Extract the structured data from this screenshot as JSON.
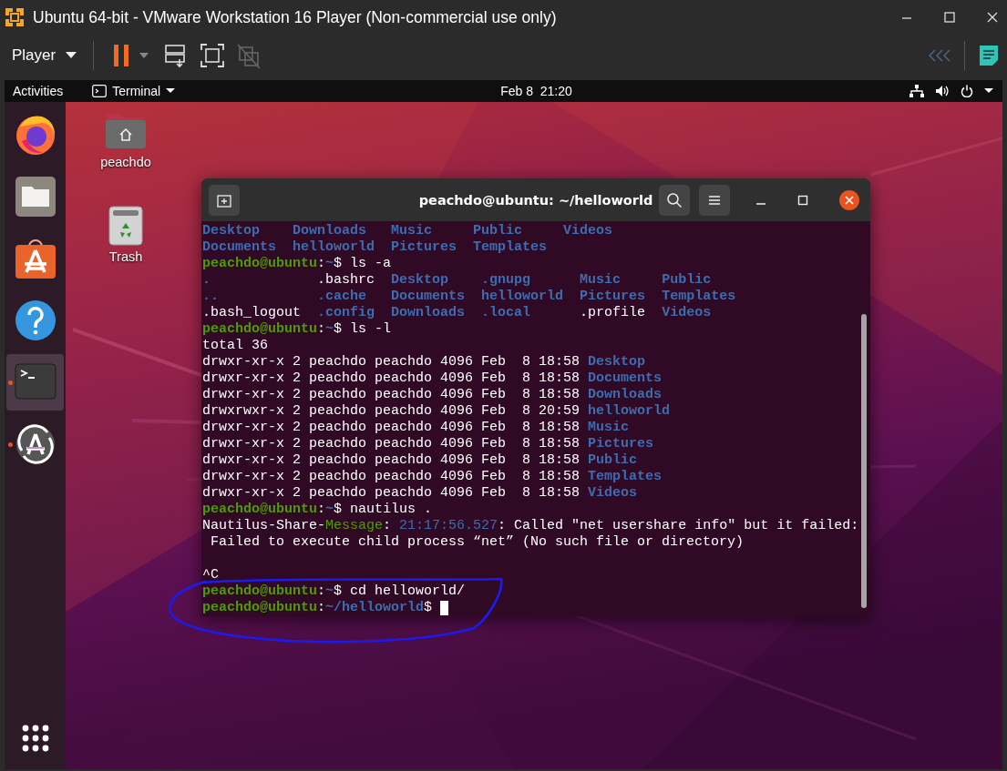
{
  "vm_window": {
    "title": "Ubuntu 64-bit - VMware Workstation 16 Player (Non-commercial use only)"
  },
  "vm_toolbar": {
    "menu": "Player",
    "buttons": [
      {
        "kind": "pause",
        "disabled": false
      },
      {
        "kind": "send_keys",
        "disabled": false
      },
      {
        "kind": "fullscreen",
        "disabled": false
      },
      {
        "kind": "unity",
        "disabled": true
      }
    ]
  },
  "top_bar": {
    "activities": "Activities",
    "app_menu": "Terminal",
    "clock": "Feb 8  21:20"
  },
  "dock": {
    "items": [
      {
        "kind": "browser",
        "selected": false,
        "running": false
      },
      {
        "kind": "files",
        "selected": false,
        "running": false
      },
      {
        "kind": "software",
        "selected": false,
        "running": false
      },
      {
        "kind": "help",
        "selected": false,
        "running": false
      },
      {
        "kind": "terminal",
        "selected": true,
        "running": true
      },
      {
        "kind": "updater",
        "selected": false,
        "running": true
      }
    ]
  },
  "desktop_icons": [
    {
      "kind": "home",
      "label": "peachdo"
    },
    {
      "kind": "trash",
      "label": "Trash"
    }
  ],
  "terminal": {
    "title": "peachdo@ubuntu: ~/helloworld",
    "cursor": true,
    "lines": [
      {
        "kind": "text",
        "segments": [
          {
            "kind": "dir",
            "text": "Desktop    "
          },
          {
            "kind": "dir",
            "text": "Downloads   "
          },
          {
            "kind": "dir",
            "text": "Music     "
          },
          {
            "kind": "dir",
            "text": "Public     "
          },
          {
            "kind": "dir",
            "text": "Videos"
          }
        ]
      },
      {
        "kind": "text",
        "segments": [
          {
            "kind": "dir",
            "text": "Documents  "
          },
          {
            "kind": "dir",
            "text": "helloworld  "
          },
          {
            "kind": "dir",
            "text": "Pictures  "
          },
          {
            "kind": "dir",
            "text": "Templates"
          }
        ]
      },
      {
        "kind": "text",
        "segments": [
          {
            "kind": "user",
            "text": "peachdo@ubuntu"
          },
          {
            "kind": "plain",
            "text": ":"
          },
          {
            "kind": "path",
            "text": "~"
          },
          {
            "kind": "plain",
            "text": "$ ls -a"
          }
        ]
      },
      {
        "kind": "text",
        "segments": [
          {
            "kind": "dir",
            "text": ".             "
          },
          {
            "kind": "plain",
            "text": ".bashrc  "
          },
          {
            "kind": "dir",
            "text": "Desktop    "
          },
          {
            "kind": "dir",
            "text": ".gnupg      "
          },
          {
            "kind": "dir",
            "text": "Music     "
          },
          {
            "kind": "dir",
            "text": "Public"
          }
        ]
      },
      {
        "kind": "text",
        "segments": [
          {
            "kind": "dir",
            "text": "..            "
          },
          {
            "kind": "dir",
            "text": ".cache   "
          },
          {
            "kind": "dir",
            "text": "Documents  "
          },
          {
            "kind": "dir",
            "text": "helloworld  "
          },
          {
            "kind": "dir",
            "text": "Pictures  "
          },
          {
            "kind": "dir",
            "text": "Templates"
          }
        ]
      },
      {
        "kind": "text",
        "segments": [
          {
            "kind": "plain",
            "text": ".bash_logout  "
          },
          {
            "kind": "dir",
            "text": ".config  "
          },
          {
            "kind": "dir",
            "text": "Downloads  "
          },
          {
            "kind": "dir",
            "text": ".local      "
          },
          {
            "kind": "plain",
            "text": ".profile  "
          },
          {
            "kind": "dir",
            "text": "Videos"
          }
        ]
      },
      {
        "kind": "text",
        "segments": [
          {
            "kind": "user",
            "text": "peachdo@ubuntu"
          },
          {
            "kind": "plain",
            "text": ":"
          },
          {
            "kind": "path",
            "text": "~"
          },
          {
            "kind": "plain",
            "text": "$ ls -l"
          }
        ]
      },
      {
        "kind": "text",
        "segments": [
          {
            "kind": "plain",
            "text": "total 36"
          }
        ]
      },
      {
        "kind": "text",
        "segments": [
          {
            "kind": "plain",
            "text": "drwxr-xr-x 2 peachdo peachdo 4096 Feb  8 18:58 "
          },
          {
            "kind": "dir",
            "text": "Desktop"
          }
        ]
      },
      {
        "kind": "text",
        "segments": [
          {
            "kind": "plain",
            "text": "drwxr-xr-x 2 peachdo peachdo 4096 Feb  8 18:58 "
          },
          {
            "kind": "dir",
            "text": "Documents"
          }
        ]
      },
      {
        "kind": "text",
        "segments": [
          {
            "kind": "plain",
            "text": "drwxr-xr-x 2 peachdo peachdo 4096 Feb  8 18:58 "
          },
          {
            "kind": "dir",
            "text": "Downloads"
          }
        ]
      },
      {
        "kind": "text",
        "segments": [
          {
            "kind": "plain",
            "text": "drwxrwxr-x 2 peachdo peachdo 4096 Feb  8 20:59 "
          },
          {
            "kind": "dir",
            "text": "helloworld"
          }
        ]
      },
      {
        "kind": "text",
        "segments": [
          {
            "kind": "plain",
            "text": "drwxr-xr-x 2 peachdo peachdo 4096 Feb  8 18:58 "
          },
          {
            "kind": "dir",
            "text": "Music"
          }
        ]
      },
      {
        "kind": "text",
        "segments": [
          {
            "kind": "plain",
            "text": "drwxr-xr-x 2 peachdo peachdo 4096 Feb  8 18:58 "
          },
          {
            "kind": "dir",
            "text": "Pictures"
          }
        ]
      },
      {
        "kind": "text",
        "segments": [
          {
            "kind": "plain",
            "text": "drwxr-xr-x 2 peachdo peachdo 4096 Feb  8 18:58 "
          },
          {
            "kind": "dir",
            "text": "Public"
          }
        ]
      },
      {
        "kind": "text",
        "segments": [
          {
            "kind": "plain",
            "text": "drwxr-xr-x 2 peachdo peachdo 4096 Feb  8 18:58 "
          },
          {
            "kind": "dir",
            "text": "Templates"
          }
        ]
      },
      {
        "kind": "text",
        "segments": [
          {
            "kind": "plain",
            "text": "drwxr-xr-x 2 peachdo peachdo 4096 Feb  8 18:58 "
          },
          {
            "kind": "dir",
            "text": "Videos"
          }
        ]
      },
      {
        "kind": "text",
        "segments": [
          {
            "kind": "user",
            "text": "peachdo@ubuntu"
          },
          {
            "kind": "plain",
            "text": ":"
          },
          {
            "kind": "path",
            "text": "~"
          },
          {
            "kind": "plain",
            "text": "$ nautilus ."
          }
        ]
      },
      {
        "kind": "text",
        "segments": [
          {
            "kind": "plain",
            "text": "Nautilus-Share-"
          },
          {
            "kind": "msg",
            "text": "Message"
          },
          {
            "kind": "plain",
            "text": ": "
          },
          {
            "kind": "time",
            "text": "21:17:56.527"
          },
          {
            "kind": "plain",
            "text": ": Called \"net usershare info\" but it failed:"
          }
        ]
      },
      {
        "kind": "text",
        "segments": [
          {
            "kind": "plain",
            "text": " Failed to execute child process “net” (No such file or directory)"
          }
        ]
      },
      {
        "kind": "blank"
      },
      {
        "kind": "text",
        "segments": [
          {
            "kind": "plain",
            "text": "^C"
          }
        ]
      },
      {
        "kind": "text",
        "segments": [
          {
            "kind": "user",
            "text": "peachdo@ubuntu"
          },
          {
            "kind": "plain",
            "text": ":"
          },
          {
            "kind": "path",
            "text": "~"
          },
          {
            "kind": "plain",
            "text": "$ cd helloworld/"
          }
        ]
      },
      {
        "kind": "text",
        "segments": [
          {
            "kind": "user",
            "text": "peachdo@ubuntu"
          },
          {
            "kind": "plain",
            "text": ":"
          },
          {
            "kind": "path",
            "text": "~/helloworld"
          },
          {
            "kind": "plain",
            "text": "$ "
          }
        ]
      }
    ]
  }
}
